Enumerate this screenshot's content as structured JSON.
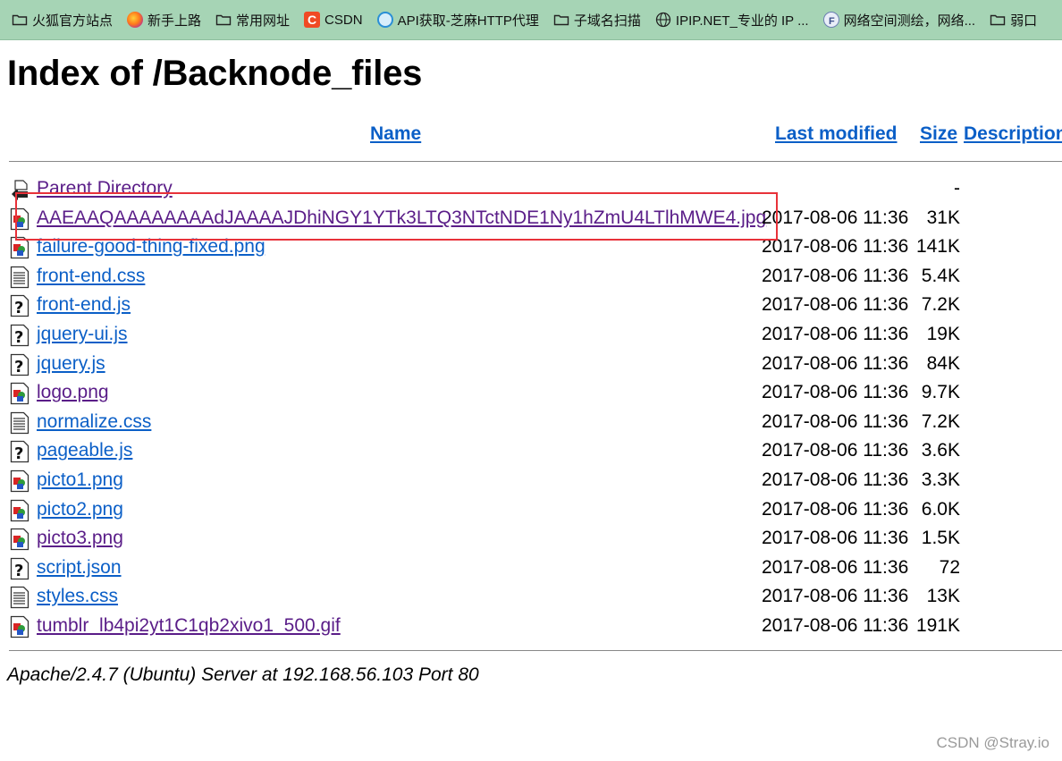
{
  "bookmarks": [
    {
      "label": "火狐官方站点",
      "icon": "folder-icon"
    },
    {
      "label": "新手上路",
      "icon": "firefox-icon"
    },
    {
      "label": "常用网址",
      "icon": "folder-icon"
    },
    {
      "label": "CSDN",
      "icon": "csdn-icon"
    },
    {
      "label": "API获取-芝麻HTTP代理",
      "icon": "api-icon"
    },
    {
      "label": "子域名扫描",
      "icon": "folder-icon"
    },
    {
      "label": "IPIP.NET_专业的 IP ...",
      "icon": "globe-icon"
    },
    {
      "label": "网络空间测绘，网络...",
      "icon": "fofa-icon"
    },
    {
      "label": "弱口",
      "icon": "folder-icon"
    }
  ],
  "page": {
    "title": "Index of /Backnode_files",
    "headers": {
      "name": "Name",
      "last_modified": "Last modified",
      "size": "Size",
      "description": "Description"
    },
    "rows": [
      {
        "name": "Parent Directory",
        "date": "",
        "size": "-",
        "icon": "back-icon",
        "visited": true
      },
      {
        "name": "AAEAAQAAAAAAAAdJAAAAJDhiNGY1YTk3LTQ3NTctNDE1Ny1hZmU4LTlhMWE4.jpg",
        "date": "2017-08-06 11:36",
        "size": "31K",
        "icon": "image-icon",
        "visited": true
      },
      {
        "name": "failure-good-thing-fixed.png",
        "date": "2017-08-06 11:36",
        "size": "141K",
        "icon": "image-icon",
        "visited": false
      },
      {
        "name": "front-end.css",
        "date": "2017-08-06 11:36",
        "size": "5.4K",
        "icon": "text-file-icon",
        "visited": false
      },
      {
        "name": "front-end.js",
        "date": "2017-08-06 11:36",
        "size": "7.2K",
        "icon": "unknown-file-icon",
        "visited": false
      },
      {
        "name": "jquery-ui.js",
        "date": "2017-08-06 11:36",
        "size": "19K",
        "icon": "unknown-file-icon",
        "visited": false
      },
      {
        "name": "jquery.js",
        "date": "2017-08-06 11:36",
        "size": "84K",
        "icon": "unknown-file-icon",
        "visited": false
      },
      {
        "name": "logo.png",
        "date": "2017-08-06 11:36",
        "size": "9.7K",
        "icon": "image-icon",
        "visited": true
      },
      {
        "name": "normalize.css",
        "date": "2017-08-06 11:36",
        "size": "7.2K",
        "icon": "text-file-icon",
        "visited": false
      },
      {
        "name": "pageable.js",
        "date": "2017-08-06 11:36",
        "size": "3.6K",
        "icon": "unknown-file-icon",
        "visited": false
      },
      {
        "name": "picto1.png",
        "date": "2017-08-06 11:36",
        "size": "3.3K",
        "icon": "image-icon",
        "visited": false
      },
      {
        "name": "picto2.png",
        "date": "2017-08-06 11:36",
        "size": "6.0K",
        "icon": "image-icon",
        "visited": false
      },
      {
        "name": "picto3.png",
        "date": "2017-08-06 11:36",
        "size": "1.5K",
        "icon": "image-icon",
        "visited": true
      },
      {
        "name": "script.json",
        "date": "2017-08-06 11:36",
        "size": "72",
        "icon": "unknown-file-icon",
        "visited": false
      },
      {
        "name": "styles.css",
        "date": "2017-08-06 11:36",
        "size": "13K",
        "icon": "text-file-icon",
        "visited": false
      },
      {
        "name": "tumblr_lb4pi2yt1C1qb2xivo1_500.gif",
        "date": "2017-08-06 11:36",
        "size": "191K",
        "icon": "image-icon",
        "visited": true
      }
    ],
    "footer": "Apache/2.4.7 (Ubuntu) Server at 192.168.56.103 Port 80"
  },
  "watermark": "CSDN @Stray.io",
  "colors": {
    "bookmarks_bg": "#a6d4b5",
    "link": "#0b5fc7",
    "visited_link": "#5a1d88",
    "highlight_box": "#e8323a"
  }
}
